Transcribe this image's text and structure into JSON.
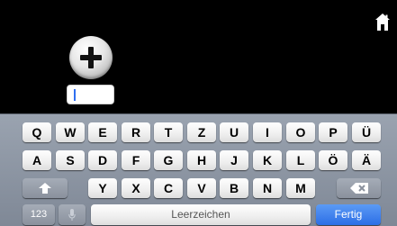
{
  "app": {
    "home_icon": "home-icon",
    "add_icon": "plus-icon",
    "text_field_value": ""
  },
  "keyboard": {
    "row1": [
      "Q",
      "W",
      "E",
      "R",
      "T",
      "Z",
      "U",
      "I",
      "O",
      "P",
      "Ü"
    ],
    "row2": [
      "A",
      "S",
      "D",
      "F",
      "G",
      "H",
      "J",
      "K",
      "L",
      "Ö",
      "Ä"
    ],
    "row3": [
      "Y",
      "X",
      "C",
      "V",
      "B",
      "N",
      "M"
    ],
    "shift_icon": "shift-arrow-icon",
    "delete_icon": "delete-backspace-icon",
    "numbers_label": "123",
    "dictation_icon": "microphone-icon",
    "space_label": "Leerzeichen",
    "done_label": "Fertig"
  },
  "colors": {
    "done_key": "#2c6ee6",
    "caret": "#2f6ff0",
    "keyboard_bg": "#8e97a4"
  }
}
